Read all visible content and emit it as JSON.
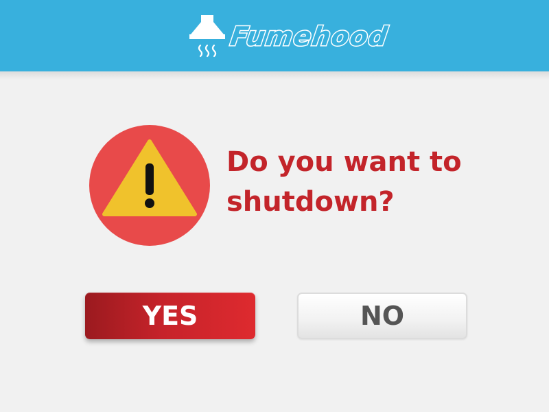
{
  "header": {
    "brand": "Fumehood",
    "background": "#38b0dd",
    "logo_icon": "fumehood-icon"
  },
  "dialog": {
    "icon": "warning-icon",
    "icon_circle_color": "#e84a4a",
    "icon_triangle_color": "#f0c22c",
    "question_line1": "Do you want to",
    "question_line2": "shutdown?",
    "question_color": "#c3242a"
  },
  "buttons": {
    "yes_label": "YES",
    "no_label": "NO",
    "yes_color": "#c6232a"
  }
}
